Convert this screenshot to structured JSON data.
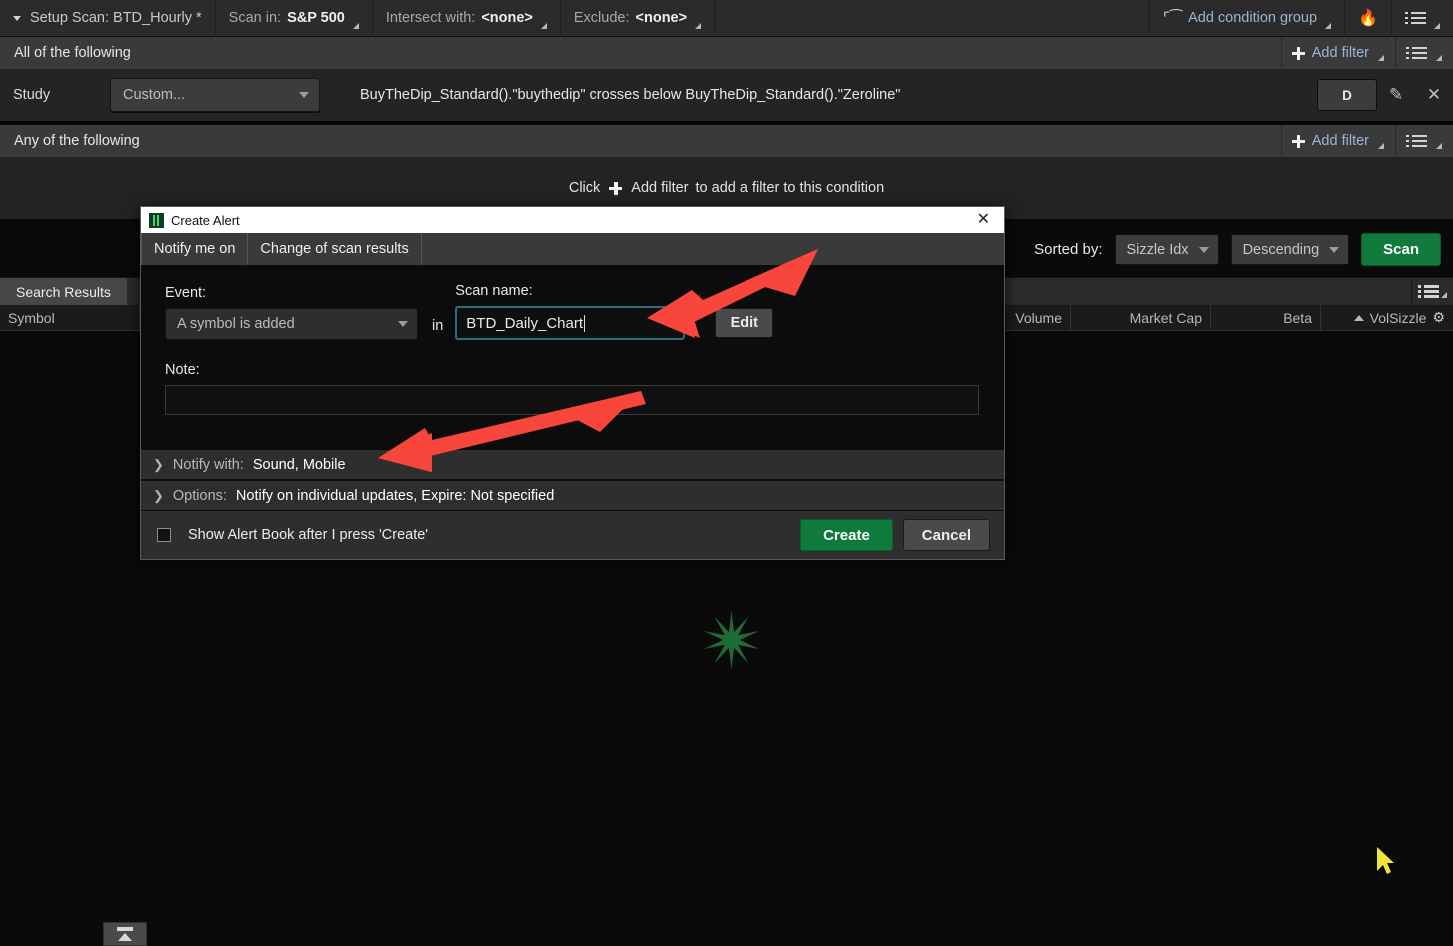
{
  "toolbar": {
    "setup_scan": "Setup Scan: BTD_Hourly *",
    "scan_in_label": "Scan in:",
    "scan_in_value": "S&P 500",
    "intersect_label": "Intersect with:",
    "intersect_value": "<none>",
    "exclude_label": "Exclude:",
    "exclude_value": "<none>",
    "add_condition_group": "Add condition group",
    "flame_icon": "flame-icon",
    "menu_icon": "list-menu-icon"
  },
  "conditions": {
    "all_of_following": "All of the following",
    "any_of_following": "Any of the following",
    "add_filter": "Add filter",
    "study_label": "Study",
    "study_dropdown": "Custom...",
    "study_formula": "BuyTheDip_Standard().\"buythedip\" crosses below BuyTheDip_Standard().\"Zeroline\"",
    "aggregation": "D",
    "edit_icon": "pencil-icon",
    "remove_icon": "close-x-icon",
    "hint_prefix": "Click",
    "hint_link": "Add filter",
    "hint_suffix": "to add a filter to this condition"
  },
  "sortbar": {
    "sorted_by_label": "Sorted by:",
    "sort_field": "Sizzle Idx",
    "sort_direction": "Descending",
    "scan_button": "Scan"
  },
  "results": {
    "tab_label": "Search Results",
    "menu_icon": "list-menu-icon",
    "columns": [
      "Symbol",
      "Volume",
      "Market Cap",
      "Beta",
      "VolSizzle"
    ],
    "sort_indicator": "sort-ascending-icon",
    "settings_icon": "gear-icon",
    "rows": [],
    "loading_spinner": "loading-spinner"
  },
  "bottom": {
    "collapse_button_icon": "collapse-up-icon"
  },
  "cursor": {
    "icon": "mouse-pointer-icon"
  },
  "dialog": {
    "title": "Create Alert",
    "app_icon": "thinkorswim-icon",
    "close_icon": "close-x-icon",
    "tabs": [
      {
        "label": "Notify me on"
      },
      {
        "label": "Change of scan results"
      }
    ],
    "event_label": "Event:",
    "event_value": "A symbol is added",
    "in_word": "in",
    "scan_name_label": "Scan name:",
    "scan_name_value": "BTD_Daily_Chart",
    "edit_button": "Edit",
    "note_label": "Note:",
    "note_value": "",
    "notify_with_label": "Notify with:",
    "notify_with_value": "Sound, Mobile",
    "options_label": "Options:",
    "options_value": "Notify on individual updates, Expire: Not specified",
    "show_alert_book_label": "Show Alert Book after I press 'Create'",
    "show_alert_book_checked": false,
    "create_button": "Create",
    "cancel_button": "Cancel"
  },
  "colors": {
    "accent_green": "#0e7a3b",
    "link_blue": "#9ab4d8",
    "annotation_red": "#f8463c",
    "input_focus": "#2e6b82"
  }
}
